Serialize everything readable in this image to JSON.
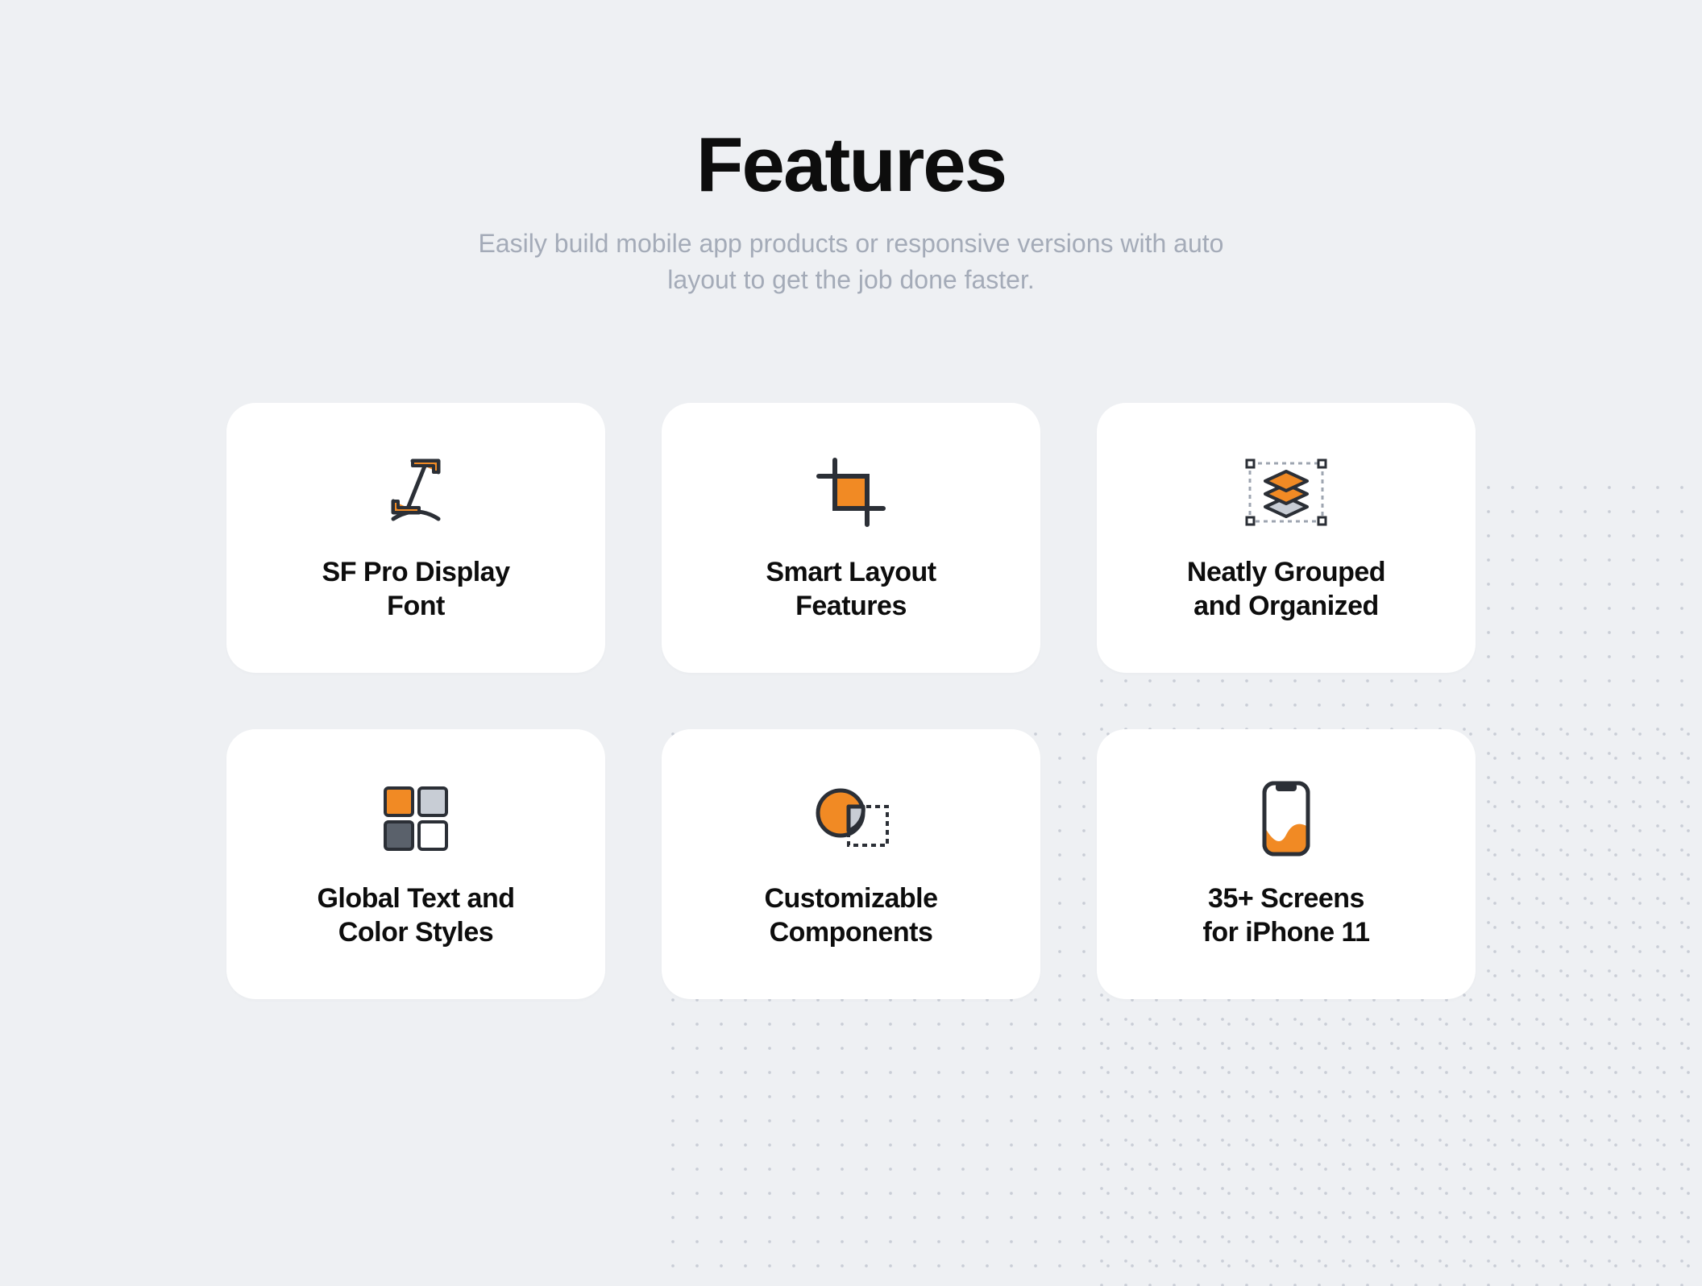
{
  "header": {
    "title": "Features",
    "subtitle": "Easily build mobile app products or responsive versions\nwith auto layout to get the job done faster."
  },
  "features": [
    {
      "icon": "italic-type-icon",
      "label": "SF Pro Display\nFont"
    },
    {
      "icon": "crop-icon",
      "label": "Smart Layout\nFeatures"
    },
    {
      "icon": "layers-icon",
      "label": "Neatly Grouped\nand Organized"
    },
    {
      "icon": "swatches-icon",
      "label": "Global Text and\nColor Styles"
    },
    {
      "icon": "shapes-icon",
      "label": "Customizable\nComponents"
    },
    {
      "icon": "phone-icon",
      "label": "35+ Screens\nfor iPhone 11"
    }
  ],
  "colors": {
    "accent": "#f18a24",
    "stroke": "#2b2f36",
    "muted": "#9ea5b0"
  }
}
